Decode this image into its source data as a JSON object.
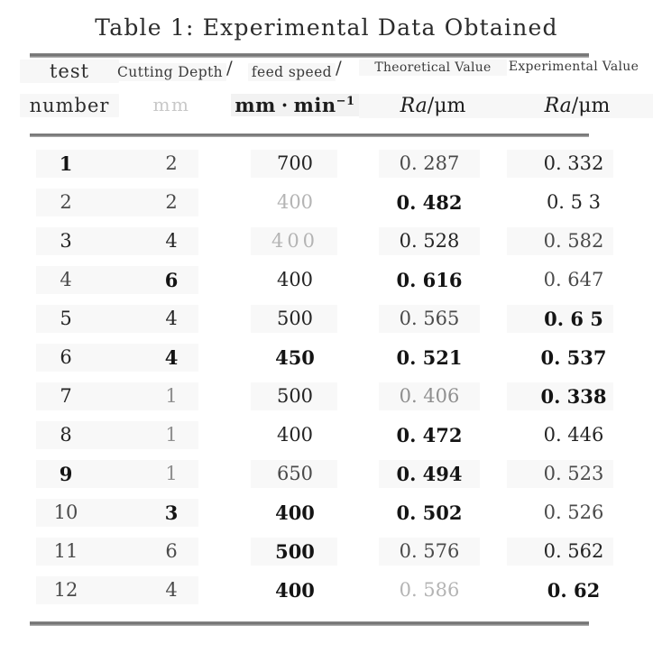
{
  "figure": {
    "caption": "Table 1: Experimental Data Obtained"
  },
  "header": {
    "col1_line1": "test",
    "col1_line2": "number",
    "col2_line1": "Cutting Depth",
    "col2_slash": "/",
    "col2_line2": "mm",
    "col3_line1": "feed speed",
    "col3_slash": "/",
    "col3_line2_a": "mm",
    "col3_line2_dot": "·",
    "col3_line2_b": "min",
    "col3_line2_sup": "−1",
    "col4_line1": "Theoretical Value",
    "col4_line2_ra": "Ra",
    "col4_line2_unit": "/μm",
    "col5_line1": "Experimental Value",
    "col5_line2_ra": "Ra",
    "col5_line2_unit": "/μm"
  },
  "chart_data": {
    "type": "table",
    "title": "Table 1: Experimental Data Obtained",
    "columns": [
      "test number",
      "Cutting Depth/mm",
      "feed speed/mm·min⁻¹",
      "Theoretical Value Ra/μm",
      "Experimental Value Ra/μm"
    ],
    "rows": [
      {
        "test_number": "1",
        "cutting_depth": "2",
        "feed_speed": "700",
        "theoretical_ra": "0. 287",
        "experimental_ra": "0. 332"
      },
      {
        "test_number": "2",
        "cutting_depth": "2",
        "feed_speed": "400",
        "theoretical_ra": "0. 482",
        "experimental_ra": "0. 5 3"
      },
      {
        "test_number": "3",
        "cutting_depth": "4",
        "feed_speed": "400",
        "theoretical_ra": "0. 528",
        "experimental_ra": "0. 582"
      },
      {
        "test_number": "4",
        "cutting_depth": "6",
        "feed_speed": "400",
        "theoretical_ra": "0. 616",
        "experimental_ra": "0. 647"
      },
      {
        "test_number": "5",
        "cutting_depth": "4",
        "feed_speed": "500",
        "theoretical_ra": "0. 565",
        "experimental_ra": "0. 6 5"
      },
      {
        "test_number": "6",
        "cutting_depth": "4",
        "feed_speed": "450",
        "theoretical_ra": "0. 521",
        "experimental_ra": "0. 537"
      },
      {
        "test_number": "7",
        "cutting_depth": "1",
        "feed_speed": "500",
        "theoretical_ra": "0. 406",
        "experimental_ra": "0. 338"
      },
      {
        "test_number": "8",
        "cutting_depth": "1",
        "feed_speed": "400",
        "theoretical_ra": "0. 472",
        "experimental_ra": "0. 446"
      },
      {
        "test_number": "9",
        "cutting_depth": "1",
        "feed_speed": "650",
        "theoretical_ra": "0. 494",
        "experimental_ra": "0. 523"
      },
      {
        "test_number": "10",
        "cutting_depth": "3",
        "feed_speed": "400",
        "theoretical_ra": "0. 502",
        "experimental_ra": "0. 526"
      },
      {
        "test_number": "11",
        "cutting_depth": "6",
        "feed_speed": "500",
        "theoretical_ra": "0. 576",
        "experimental_ra": "0. 562"
      },
      {
        "test_number": "12",
        "cutting_depth": "4",
        "feed_speed": "400",
        "theoretical_ra": "0. 586",
        "experimental_ra": "0. 62"
      }
    ]
  },
  "ink": {
    "rows": [
      {
        "n": "ink-dark",
        "d": "ink-mid",
        "f": "ink-normal",
        "t": "ink-mid",
        "e": "ink-normal"
      },
      {
        "n": "ink-mid",
        "d": "ink-mid",
        "f": "ink-faint",
        "t": "ink-dark",
        "e": "ink-normal"
      },
      {
        "n": "ink-normal",
        "d": "ink-normal",
        "f": "ink-faint",
        "t": "ink-normal",
        "e": "ink-mid"
      },
      {
        "n": "ink-mid",
        "d": "ink-dark",
        "f": "ink-normal",
        "t": "ink-dark",
        "e": "ink-mid"
      },
      {
        "n": "ink-normal",
        "d": "ink-normal",
        "f": "ink-normal",
        "t": "ink-mid",
        "e": "ink-dark"
      },
      {
        "n": "ink-normal",
        "d": "ink-dark",
        "f": "ink-dark",
        "t": "ink-dark",
        "e": "ink-dark"
      },
      {
        "n": "ink-normal",
        "d": "ink-light",
        "f": "ink-normal",
        "t": "ink-light",
        "e": "ink-dark"
      },
      {
        "n": "ink-normal",
        "d": "ink-light",
        "f": "ink-normal",
        "t": "ink-dark",
        "e": "ink-normal"
      },
      {
        "n": "ink-dark",
        "d": "ink-light",
        "f": "ink-mid",
        "t": "ink-dark",
        "e": "ink-mid"
      },
      {
        "n": "ink-mid",
        "d": "ink-dark",
        "f": "ink-dark",
        "t": "ink-dark",
        "e": "ink-mid"
      },
      {
        "n": "ink-mid",
        "d": "ink-mid",
        "f": "ink-dark",
        "t": "ink-mid",
        "e": "ink-normal"
      },
      {
        "n": "ink-mid",
        "d": "ink-mid",
        "f": "ink-dark",
        "t": "ink-faint",
        "e": "ink-dark"
      }
    ]
  },
  "colors": {
    "page_background": "#ffffff",
    "rule": "#6e6e6e",
    "ink_dark": "#141414",
    "ink_faint": "#b4b4b4",
    "band": "#f8f8f8"
  }
}
